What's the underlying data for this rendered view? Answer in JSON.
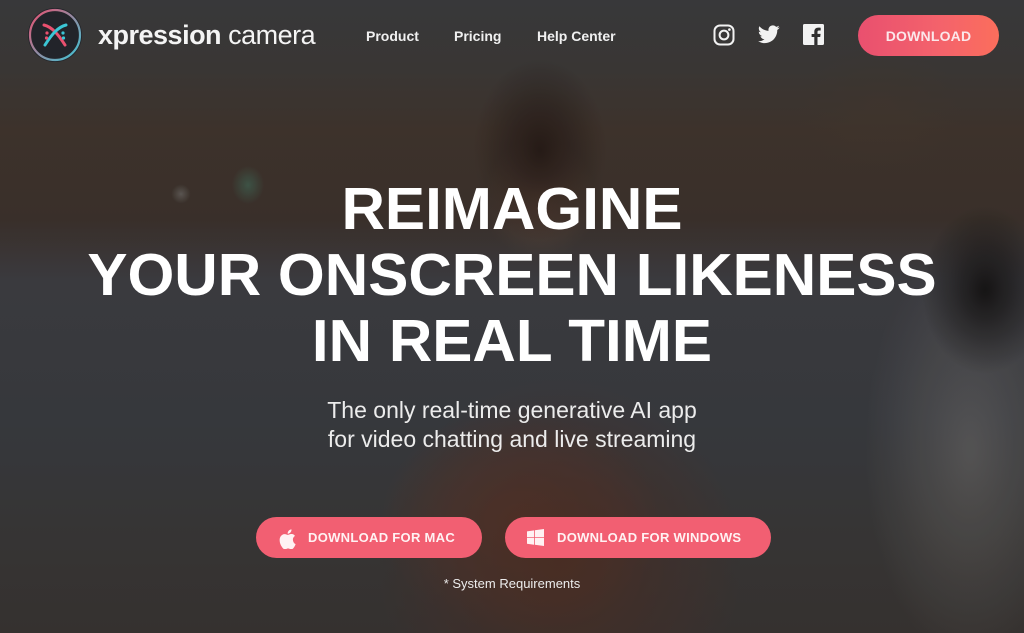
{
  "brand": {
    "name_bold": "xpression",
    "name_light": " camera",
    "logo_icon": "xpression-face-logo-icon",
    "colors": {
      "pink": "#e9506f",
      "cyan": "#3bc6d6",
      "accent": "#f25f72"
    }
  },
  "nav": {
    "items": [
      {
        "label": "Product"
      },
      {
        "label": "Pricing"
      },
      {
        "label": "Help Center"
      }
    ]
  },
  "social": [
    {
      "name": "instagram-icon"
    },
    {
      "name": "twitter-icon"
    },
    {
      "name": "facebook-icon"
    }
  ],
  "header": {
    "download_label": "DOWNLOAD"
  },
  "hero": {
    "headline": [
      "REIMAGINE",
      "YOUR ONSCREEN LIKENESS",
      "IN REAL TIME"
    ],
    "subhead": [
      "The only real-time generative AI app",
      "for video chatting and live streaming"
    ],
    "buttons": [
      {
        "label": "DOWNLOAD FOR MAC",
        "icon": "apple-icon"
      },
      {
        "label": "DOWNLOAD FOR WINDOWS",
        "icon": "windows-icon"
      }
    ],
    "system_requirements": "* System Requirements"
  }
}
